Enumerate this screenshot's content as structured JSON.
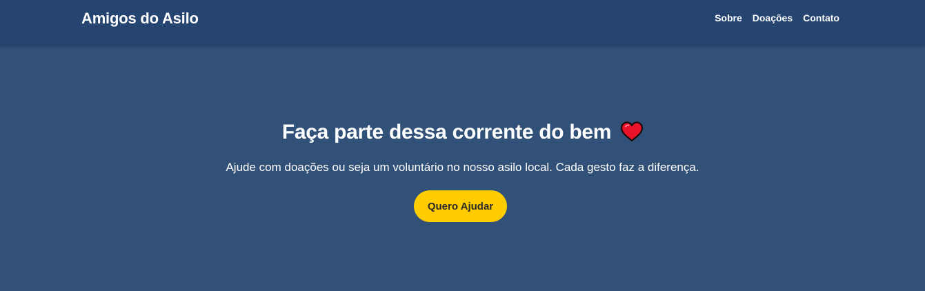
{
  "header": {
    "brand": "Amigos do Asilo",
    "nav": [
      {
        "label": "Sobre"
      },
      {
        "label": "Doações"
      },
      {
        "label": "Contato"
      }
    ]
  },
  "hero": {
    "title": "Faça parte dessa corrente do bem",
    "title_icon": "heart-icon",
    "subtitle": "Ajude com doações ou seja um voluntário no nosso asilo local. Cada gesto faz a diferença.",
    "cta_label": "Quero Ajudar"
  },
  "colors": {
    "header_bg": "#254470",
    "hero_bg": "#325178",
    "accent": "#ffcc00",
    "heart": "#e8132b"
  }
}
